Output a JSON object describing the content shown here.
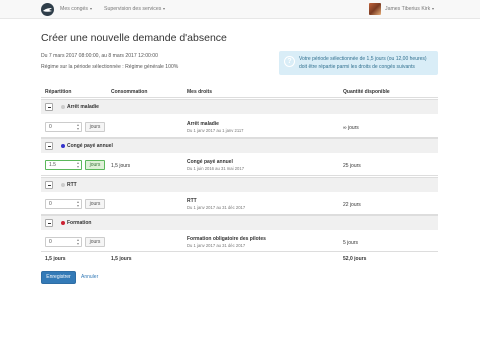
{
  "navbar": {
    "logo_icon": "bird-logo-icon",
    "menu_conges": "Mes congés",
    "menu_services": "Supervision des services",
    "user_name": "James Tiberius Kirk"
  },
  "page": {
    "title": "Créer une nouvelle demande d'absence",
    "period": "Du 7 mars 2017 08:00:00, au 8 mars 2017 12:00:00",
    "regime": "Régime sur la période sélectionnée : Régime générale 100%"
  },
  "info": {
    "line1": "Votre période sélectionnée de 1,5 jours (ou 12,00 heures)",
    "line2": "doit être répartie parmi les droits de congés suivants"
  },
  "table": {
    "headers": {
      "repartition": "Répartition",
      "consommation": "Consommation",
      "droits": "Mes droits",
      "quantite": "Quantité disponible"
    },
    "groups": [
      {
        "name": "Arrêt maladie",
        "color": "#cccccc",
        "value": "0",
        "unit": "jours",
        "consommation": "",
        "droit": "Arrêt maladie",
        "droit_dates": "Du 1 janv 2017 au 1 janv 2117",
        "quantite": "∞ jours"
      },
      {
        "name": "Congé payé annuel",
        "color": "#3333cc",
        "value": "1.5",
        "unit": "jours",
        "consommation": "1,5 jours",
        "droit": "Congé payé annuel",
        "droit_dates": "Du 1 juin 2016 au 31 mai 2017",
        "quantite": "25 jours"
      },
      {
        "name": "RTT",
        "color": "#cccccc",
        "value": "0",
        "unit": "jours",
        "consommation": "",
        "droit": "RTT",
        "droit_dates": "Du 1 janv 2017 au 31 déc 2017",
        "quantite": "22 jours"
      },
      {
        "name": "Formation",
        "color": "#cc2233",
        "value": "0",
        "unit": "jours",
        "consommation": "",
        "droit": "Formation obligatoire des pilotes",
        "droit_dates": "Du 1 janv 2017 au 31 déc 2017",
        "quantite": "5 jours"
      }
    ],
    "totals": {
      "repartition": "1,5 jours",
      "consommation": "1,5 jours",
      "quantite": "52,0 jours"
    }
  },
  "actions": {
    "save": "Enregistrer",
    "cancel": "Annuler"
  }
}
